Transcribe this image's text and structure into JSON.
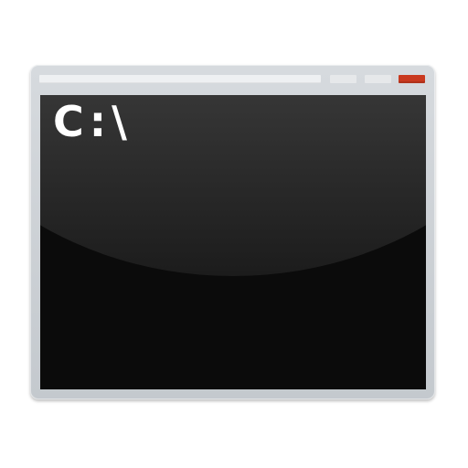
{
  "console": {
    "prompt_text": "C:\\"
  },
  "icons": {
    "minimize": "minimize-icon",
    "maximize": "maximize-icon",
    "close": "close-icon"
  },
  "colors": {
    "close_button": "#c9391f",
    "console_background": "#0b0b0b",
    "window_frame": "#cdd1d5"
  }
}
